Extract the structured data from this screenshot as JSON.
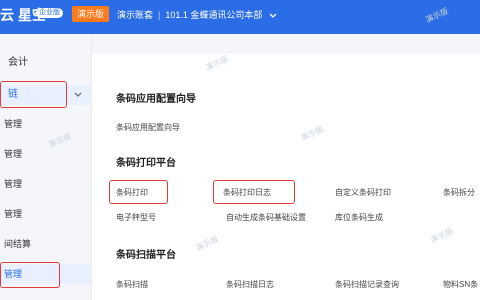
{
  "header": {
    "logo_text": "云 星空",
    "logo_badge": "企业版",
    "demo_label": "演示版",
    "account_label": "演示账套",
    "org_label": "101.1 金蝶通讯公司本部",
    "org_chevron": "chevron-down-icon"
  },
  "watermark_text": "演示版",
  "sidebar": {
    "items": [
      {
        "label": "会计"
      },
      {
        "label": "链"
      },
      {
        "label": "管理"
      },
      {
        "label": "管理"
      },
      {
        "label": "管理"
      },
      {
        "label": "管理"
      },
      {
        "label": "间结算"
      },
      {
        "label": "管理"
      }
    ],
    "expand_icon": "chevron-down-icon"
  },
  "sections": [
    {
      "title": "条码应用配置向导",
      "links": [
        "条码应用配置向导"
      ]
    },
    {
      "title": "条码打印平台",
      "links": [
        "条码打印",
        "条码打印日志",
        "自定义条码打印",
        "条码拆分",
        "电子秤型号",
        "自动生成条码基础设置",
        "库位条码生成"
      ]
    },
    {
      "title": "条码扫描平台",
      "links": [
        "条码扫描",
        "条码扫描日志",
        "条码扫描记录查询",
        "物料SN条"
      ]
    }
  ],
  "colors": {
    "header_bg": "#2a6de6",
    "demo_badge": "#ff7a1a",
    "highlight_box": "#e23b3b",
    "active_item_bg": "#e8efff"
  }
}
